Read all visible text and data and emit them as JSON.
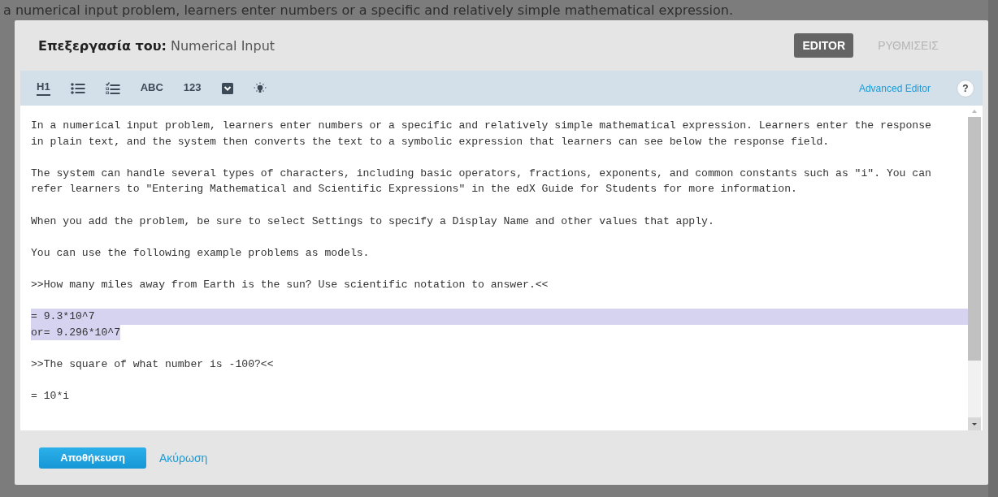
{
  "background_text": "a numerical input problem, learners enter numbers or a specific and relatively simple mathematical expression.",
  "modal": {
    "title": "**Επεξεργασία του:** Numerical Input",
    "tabs": [
      {
        "label": "EDITOR",
        "selected": true
      },
      {
        "label": "ΡΥΘΜΙΣΕΙΣ",
        "selected": false
      }
    ],
    "toolbar": [
      {
        "kind": "text",
        "label": "H1",
        "underline": true
      },
      {
        "kind": "bullet-list"
      },
      {
        "kind": "checklist"
      },
      {
        "kind": "text",
        "label": "ABC",
        "underline": false
      },
      {
        "kind": "text",
        "label": "123",
        "underline": false
      },
      {
        "kind": "dropdown"
      },
      {
        "kind": "hint"
      }
    ],
    "advanced_link": "Advanced Editor",
    "help": "?",
    "paragraphs": [
      [
        {
          "text": "In a numerical input problem, learners enter numbers or a specific and relatively simple mathematical expression. Learners enter the response",
          "selected": false
        },
        {
          "text": "in plain text, and the system then converts the text to a symbolic expression that learners can see below the response field.",
          "selected": false
        }
      ],
      [
        {
          "text": "The system can handle several types of characters, including basic operators, fractions, exponents, and common constants such as \"i\". You can",
          "selected": false
        },
        {
          "text": "refer learners to \"Entering Mathematical and Scientific Expressions\" in the edX Guide for Students for more information.",
          "selected": false
        }
      ],
      [
        {
          "text": "When you add the problem, be sure to select Settings to specify a Display Name and other values that apply.",
          "selected": false
        }
      ],
      [
        {
          "text": "You can use the following example problems as models.",
          "selected": false
        }
      ],
      [
        {
          "text": ">>How many miles away from Earth is the sun? Use scientific notation to answer.<<",
          "selected": false
        }
      ],
      [
        {
          "text": "= 9.3*10^7",
          "selected": true
        },
        {
          "text": "or= 9.296*10^7",
          "selected": true
        }
      ],
      [
        {
          "text": ">>The square of what number is -100?<<",
          "selected": false
        }
      ],
      [
        {
          "text": "= 10*i",
          "selected": false
        }
      ]
    ],
    "save": "Αποθήκευση",
    "cancel": "Ακύρωση"
  }
}
